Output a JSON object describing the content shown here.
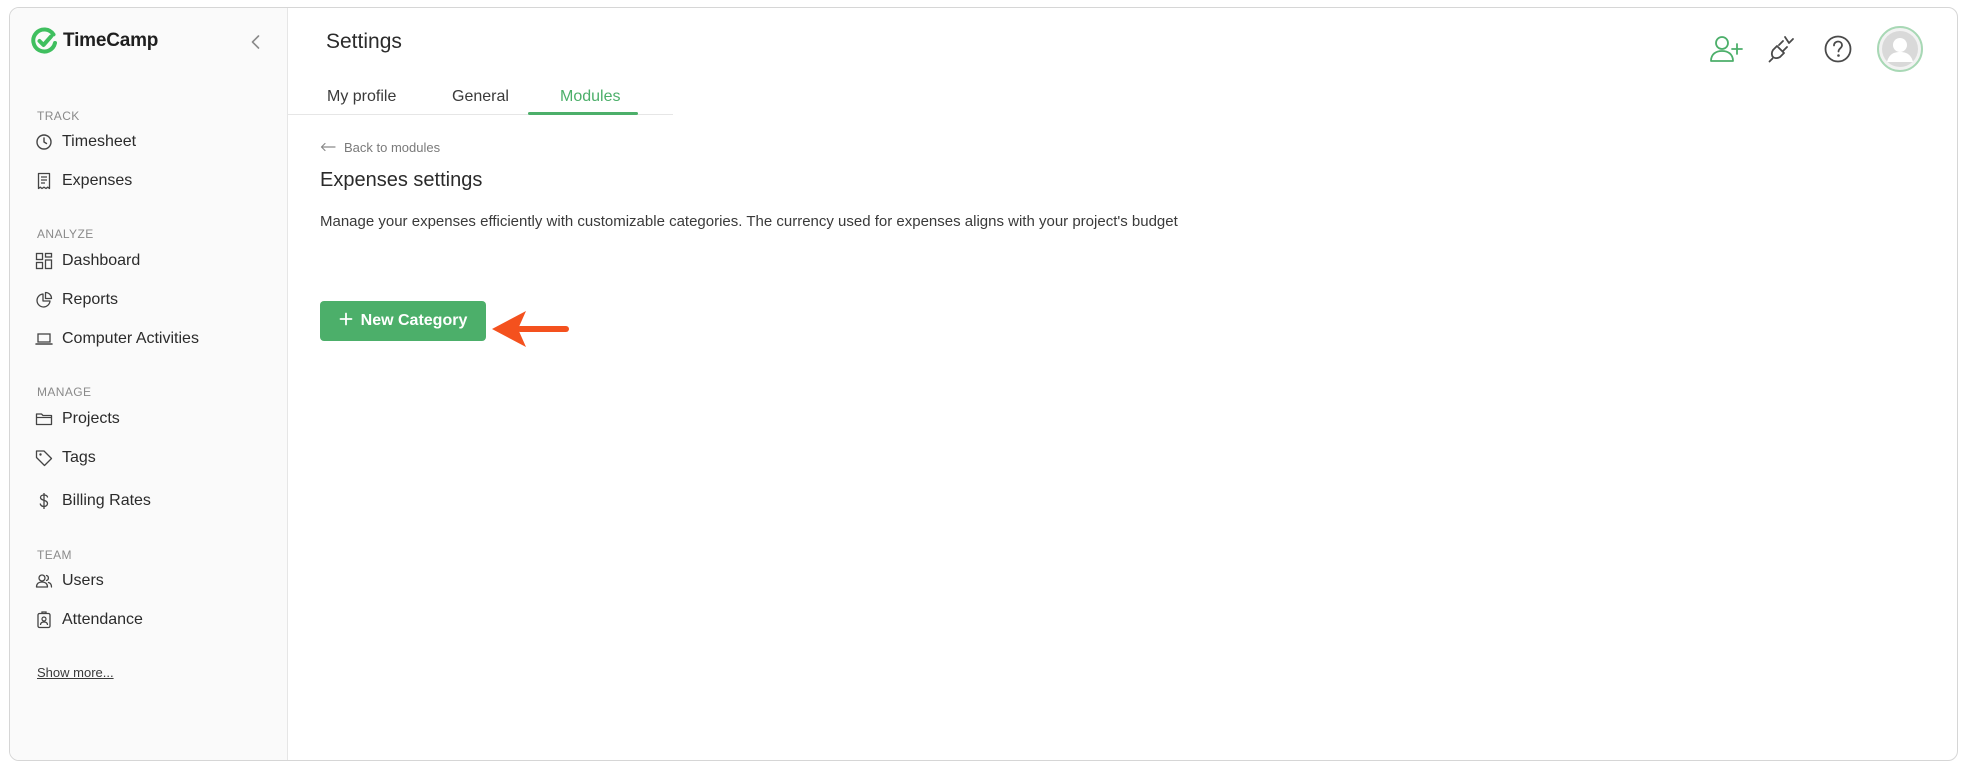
{
  "app": {
    "name": "TimeCamp",
    "brand_color": "#4caf6a",
    "accent_arrow_color": "#f4511e"
  },
  "sidebar": {
    "sections": [
      {
        "label": "TRACK",
        "items": [
          {
            "label": "Timesheet",
            "icon": "clock-icon"
          },
          {
            "label": "Expenses",
            "icon": "receipt-icon"
          }
        ]
      },
      {
        "label": "ANALYZE",
        "items": [
          {
            "label": "Dashboard",
            "icon": "dashboard-icon"
          },
          {
            "label": "Reports",
            "icon": "pie-chart-icon"
          },
          {
            "label": "Computer Activities",
            "icon": "laptop-icon"
          }
        ]
      },
      {
        "label": "MANAGE",
        "items": [
          {
            "label": "Projects",
            "icon": "folder-icon"
          },
          {
            "label": "Tags",
            "icon": "tag-icon"
          },
          {
            "label": "Billing Rates",
            "icon": "dollar-icon"
          }
        ]
      },
      {
        "label": "TEAM",
        "items": [
          {
            "label": "Users",
            "icon": "users-icon"
          },
          {
            "label": "Attendance",
            "icon": "badge-icon"
          }
        ]
      }
    ],
    "show_more": "Show more..."
  },
  "header": {
    "title": "Settings",
    "tabs": [
      {
        "label": "My profile",
        "active": false
      },
      {
        "label": "General",
        "active": false
      },
      {
        "label": "Modules",
        "active": true
      }
    ],
    "icons": [
      "add-user-icon",
      "plug-icon",
      "help-icon",
      "avatar"
    ]
  },
  "content": {
    "back_link": "Back to modules",
    "title": "Expenses settings",
    "description": "Manage your expenses efficiently with customizable categories. The currency used for expenses aligns with your project's budget",
    "new_category_button": "New Category"
  }
}
